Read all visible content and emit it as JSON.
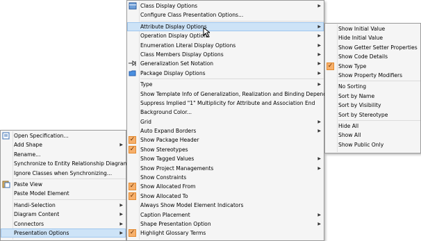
{
  "left_menu": {
    "items": [
      {
        "label": "Open Specification...",
        "icon": "spec-icon"
      },
      {
        "label": "Add Shape",
        "submenu": true
      },
      {
        "label": "Rename..."
      },
      {
        "label": "Synchronize to Entity Relationship Diagram"
      },
      {
        "label": "Ignore Classes when Synchronizing..."
      },
      {
        "label": "Paste View",
        "icon": "paste-icon"
      },
      {
        "label": "Paste Model Element"
      },
      {
        "label": "Handi-Selection",
        "submenu": true
      },
      {
        "label": "Diagram Content",
        "submenu": true
      },
      {
        "label": "Connectors",
        "submenu": true
      },
      {
        "label": "Presentation Options",
        "submenu": true
      }
    ]
  },
  "middle_menu": {
    "items": [
      {
        "label": "Class Display Options",
        "submenu": true,
        "icon": "class-display-icon"
      },
      {
        "label": "Configure Class Presentation Options..."
      },
      {
        "label": "Attribute Display Options",
        "submenu": true
      },
      {
        "label": "Operation Display Options",
        "submenu": true
      },
      {
        "label": "Enumeration Literal Display Options",
        "submenu": true
      },
      {
        "label": "Class Members Display Options",
        "submenu": true
      },
      {
        "label": "Generalization Set Notation",
        "submenu": true,
        "icon": "generalization-icon"
      },
      {
        "label": "Package Display Options",
        "submenu": true,
        "icon": "folder-icon"
      },
      {
        "label": "Type",
        "submenu": true
      },
      {
        "label": "Show Template Info of Generalization, Realization and Binding Dependency"
      },
      {
        "label": "Suppress Implied \"1\" Multiplicity for Attribute and Association End"
      },
      {
        "label": "Background Color..."
      },
      {
        "label": "Grid",
        "submenu": true
      },
      {
        "label": "Auto Expand Borders",
        "submenu": true
      },
      {
        "label": "Show Package Header",
        "checked": true
      },
      {
        "label": "Show Stereotypes",
        "checked": true
      },
      {
        "label": "Show Tagged Values",
        "submenu": true
      },
      {
        "label": "Show Project Managements",
        "submenu": true
      },
      {
        "label": "Show Constraints"
      },
      {
        "label": "Show Allocated From",
        "checked": true
      },
      {
        "label": "Show Allocated To",
        "checked": true
      },
      {
        "label": "Always Show Model Element Indicators"
      },
      {
        "label": "Caption Placement",
        "submenu": true
      },
      {
        "label": "Shape Presentation Option",
        "submenu": true
      },
      {
        "label": "Highlight Glossary Terms",
        "checked": true
      }
    ]
  },
  "right_menu": {
    "items": [
      {
        "label": "Show Initial Value"
      },
      {
        "label": "Hide Initial Value"
      },
      {
        "label": "Show Getter Setter Properties"
      },
      {
        "label": "Show Code Details"
      },
      {
        "label": "Show Type",
        "checked": true
      },
      {
        "label": "Show Property Modifiers"
      },
      {
        "label": "No Sorting"
      },
      {
        "label": "Sort by Name"
      },
      {
        "label": "Sort by Visibility"
      },
      {
        "label": "Sort by Stereotype"
      },
      {
        "label": "Hide All"
      },
      {
        "label": "Show All"
      },
      {
        "label": "Show Public Only"
      }
    ]
  },
  "colors": {
    "highlight": "#cde3f7",
    "check": "#f6b06c",
    "accent": "#2b6fd6"
  }
}
